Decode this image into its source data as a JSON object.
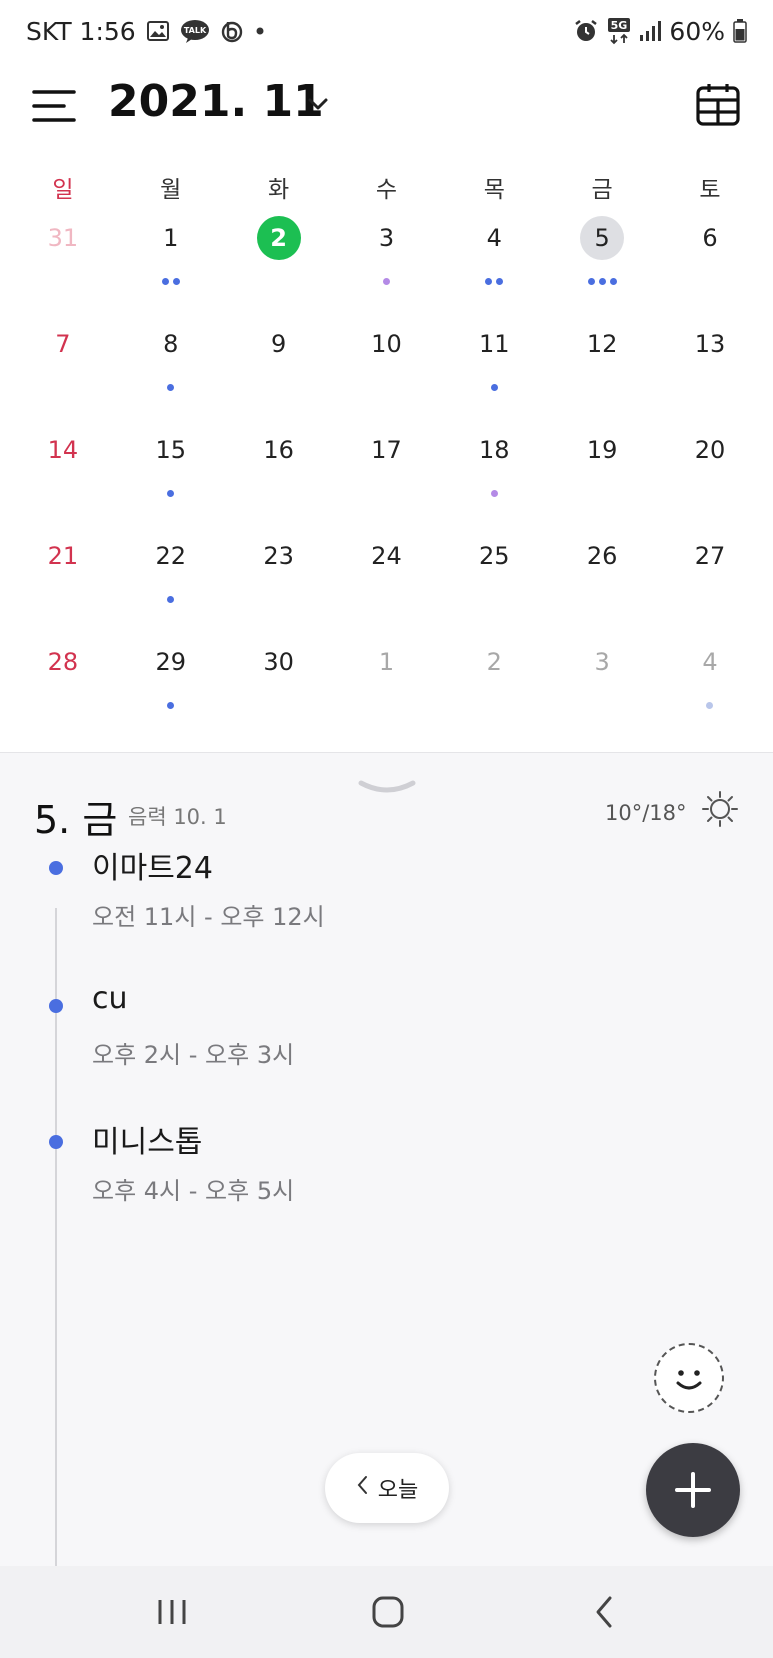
{
  "status_bar": {
    "carrier_time": "SKT 1:56",
    "talk_badge": "TALK",
    "network": "5G",
    "battery": "60%",
    "left_icons": [
      "gallery-icon",
      "kakaotalk-icon",
      "band-icon",
      "more-notifications-icon"
    ],
    "right_icons": [
      "alarm-icon",
      "5g-icon",
      "signal-icon",
      "battery-icon"
    ]
  },
  "header": {
    "month_title": "2021. 11",
    "icons": [
      "menu-icon",
      "chevron-down-icon",
      "calendar-view-icon"
    ]
  },
  "weekdays": [
    "일",
    "월",
    "화",
    "수",
    "목",
    "금",
    "토"
  ],
  "colors": {
    "today": "#1cbf52",
    "selected": "#dedfe3",
    "sunday": "#d2334f",
    "event_blue": "#4a6ee0",
    "event_purple": "#b48ae6",
    "event_faint": "#b9c6ea"
  },
  "calendar": {
    "weeks": [
      [
        {
          "day": "31",
          "out": true,
          "dots": []
        },
        {
          "day": "1",
          "dots": [
            "#4a6ee0",
            "#4a6ee0"
          ]
        },
        {
          "day": "2",
          "today": true,
          "dots": []
        },
        {
          "day": "3",
          "dots": [
            "#b48ae6"
          ]
        },
        {
          "day": "4",
          "dots": [
            "#4a6ee0",
            "#4a6ee0"
          ]
        },
        {
          "day": "5",
          "selected": true,
          "dots": [
            "#4a6ee0",
            "#4a6ee0",
            "#4a6ee0"
          ]
        },
        {
          "day": "6",
          "dots": []
        }
      ],
      [
        {
          "day": "7",
          "dots": []
        },
        {
          "day": "8",
          "dots": [
            "#4a6ee0"
          ]
        },
        {
          "day": "9",
          "dots": []
        },
        {
          "day": "10",
          "dots": []
        },
        {
          "day": "11",
          "dots": [
            "#4a6ee0"
          ]
        },
        {
          "day": "12",
          "dots": []
        },
        {
          "day": "13",
          "dots": []
        }
      ],
      [
        {
          "day": "14",
          "dots": []
        },
        {
          "day": "15",
          "dots": [
            "#4a6ee0"
          ]
        },
        {
          "day": "16",
          "dots": []
        },
        {
          "day": "17",
          "dots": []
        },
        {
          "day": "18",
          "dots": [
            "#b48ae6"
          ]
        },
        {
          "day": "19",
          "dots": []
        },
        {
          "day": "20",
          "dots": []
        }
      ],
      [
        {
          "day": "21",
          "dots": []
        },
        {
          "day": "22",
          "dots": [
            "#4a6ee0"
          ]
        },
        {
          "day": "23",
          "dots": []
        },
        {
          "day": "24",
          "dots": []
        },
        {
          "day": "25",
          "dots": []
        },
        {
          "day": "26",
          "dots": []
        },
        {
          "day": "27",
          "dots": []
        }
      ],
      [
        {
          "day": "28",
          "dots": []
        },
        {
          "day": "29",
          "dots": [
            "#4a6ee0"
          ]
        },
        {
          "day": "30",
          "dots": []
        },
        {
          "day": "1",
          "out": true,
          "dots": []
        },
        {
          "day": "2",
          "out": true,
          "dots": []
        },
        {
          "day": "3",
          "out": true,
          "dots": []
        },
        {
          "day": "4",
          "out": true,
          "dots": [
            "#b9c6ea"
          ]
        }
      ]
    ]
  },
  "day_detail": {
    "selected_day": "5. 금",
    "lunar": "음력 10. 1",
    "weather": "10°/18°",
    "icons": [
      "collapse-handle-icon",
      "sun-icon"
    ],
    "events": [
      {
        "title": "이마트24",
        "time": "오전 11시 - 오후 12시"
      },
      {
        "title": "cu",
        "time": "오후 2시 - 오후 3시"
      },
      {
        "title": "미니스톱",
        "time": "오후 4시 - 오후 5시"
      }
    ]
  },
  "actions": {
    "today_label": "오늘",
    "icons": [
      "emoji-sticker-icon",
      "plus-icon",
      "chevron-left-icon"
    ]
  },
  "nav_bar": {
    "icons": [
      "recent-apps-icon",
      "home-icon",
      "back-icon"
    ]
  }
}
